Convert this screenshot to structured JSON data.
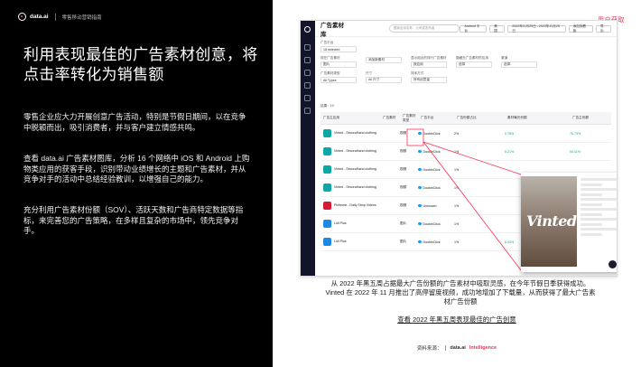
{
  "brand": {
    "logo": "data.ai",
    "subtitle": "零售移动营销指南"
  },
  "headline": "利用表现最佳的广告素材创意，将点击率转化为销售额",
  "paragraphs": [
    "零售企业应大力开展创意广告活动，特别是节假日期间，以在竞争中脱颖而出，吸引消费者，并与客户建立情感共鸣。",
    "查看 data.ai 广告素材图库，分析 16 个网络中 iOS 和 Android 上购物类应用的获客手段，识别带动业绩增长的主题和广告素材，并从竞争对手的活动中总结经验教训，以增强自己的能力。",
    "充分利用广告素材份额（SOV）、活跃天数和广告商特定数据等指标，来完善您的广告策略，在多样且复杂的市场中，领先竞争对手。"
  ],
  "cta_tag": "用户获取",
  "screenshot": {
    "title": "广告素材库",
    "search_placeholder": "搜索应用名称、公司或发布者",
    "tools": [
      "Android 平台",
      "美国",
      "2022年11月25日 - 2022年11月25日",
      "添加到看板",
      "导出"
    ],
    "filter_rows": [
      [
        {
          "label": "广告平台",
          "value": "16 selected"
        }
      ],
      [
        {
          "label": "现在广告素材",
          "value": "图片"
        },
        {
          "label": "",
          "value": "添加新素材"
        },
        {
          "label": "显示组合的排行广告素材",
          "value": "按应用"
        },
        {
          "label": "隐藏无广告素材的应用",
          "value": "选择"
        },
        {
          "label": "渠道",
          "value": "选择"
        }
      ],
      [
        {
          "label": "广告素材类型",
          "value": "All Types"
        },
        {
          "label": "尺寸",
          "value": "All 尺寸"
        },
        {
          "label": "排序方式",
          "value": "所有创意量"
        }
      ]
    ],
    "table": {
      "count": "结果：10",
      "headers": [
        "广告主应用",
        "广告素材",
        "广告素材类型",
        "广告平台",
        "广告份额占比",
        "素材曝光份额",
        "广告主份额"
      ],
      "rows": [
        {
          "app": "Vinted - Secondhand clothing",
          "thumb": "photo",
          "type": "视频",
          "platform": "DoubleClick",
          "sov": "2%",
          "ctr": "0.78%",
          "trend": "76.73%"
        },
        {
          "app": "Vinted - Secondhand clothing",
          "thumb": "photo",
          "type": "视频",
          "platform": "DoubleClick",
          "sov": "1%",
          "ctr": "5.21%",
          "trend": "54.11%"
        },
        {
          "app": "Vinted - Secondhand clothing",
          "thumb": "photo",
          "type": "视频",
          "platform": "DoubleClick",
          "sov": "1%",
          "ctr": "",
          "trend": ""
        },
        {
          "app": "Vinted - Secondhand clothing",
          "thumb": "photo",
          "type": "视频",
          "platform": "DoubleClick",
          "sov": "1%",
          "ctr": "",
          "trend": ""
        },
        {
          "app": "Pinterest - Daily Shop Videos",
          "thumb": "pin",
          "type": "视频",
          "platform": "Unknown",
          "sov": "1%",
          "ctr": "",
          "trend": ""
        },
        {
          "app": "Lidl Plus",
          "thumb": "lidl",
          "type": "图片",
          "platform": "DoubleClick",
          "sov": "1%",
          "ctr": "",
          "trend": ""
        },
        {
          "app": "Lidl Plus",
          "thumb": "lidl",
          "type": "图片",
          "platform": "DoubleClick",
          "sov": "1%",
          "ctr": "6.93%",
          "trend": "26.14%"
        }
      ]
    },
    "popup_brand": "Vinted"
  },
  "caption": "从 2022 年黑五周占据最大广告份额的广告素材中吸取灵感，在今年节假日季获得成功。Vinted 在 2022 年 11 月推出了高停留度视频，成功地增加了下载量，从而获得了最大广告素材广告份额",
  "link_text": "查看 2022 年黑五周表现最佳的广告创意",
  "source": {
    "label": "资料来源：",
    "brand": "data.ai",
    "brand_suffix": "Intelligence"
  },
  "colors": {
    "accent": "#ff2d55",
    "panel": "#000000",
    "positive": "#22a06b"
  }
}
